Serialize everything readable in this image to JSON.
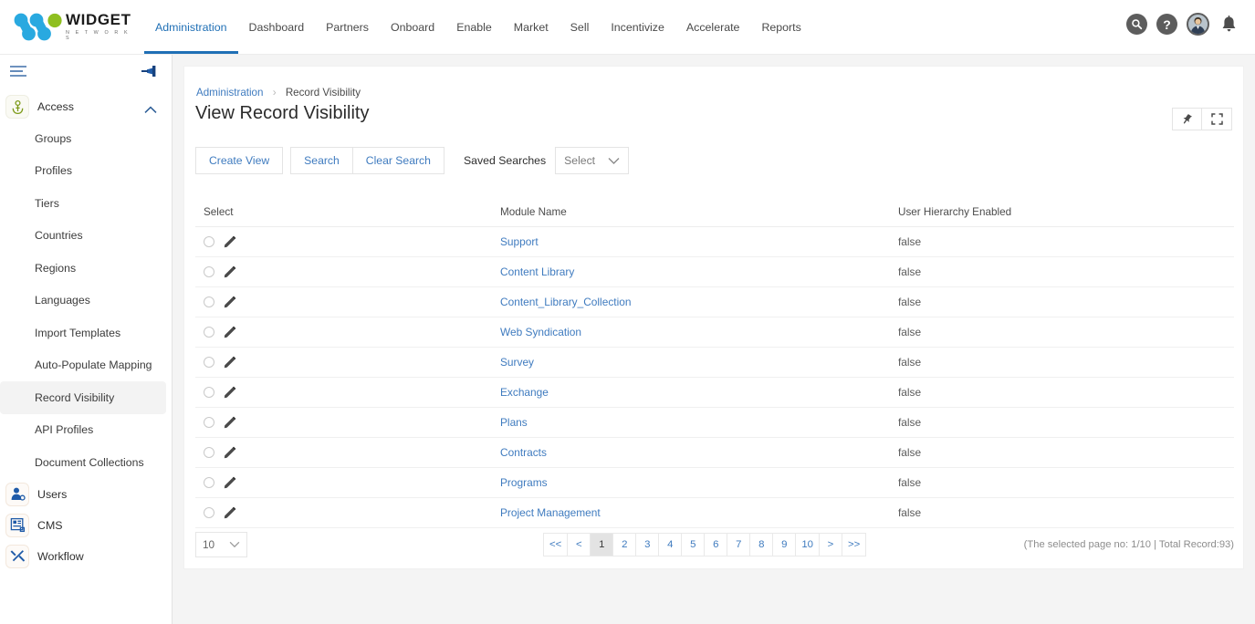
{
  "brand": {
    "name": "WIDGET",
    "tagline": "N E T W O R K S",
    "logo_colors": {
      "blue": "#29a9e0",
      "green": "#8fbf20"
    }
  },
  "topnav": {
    "items": [
      {
        "label": "Administration",
        "active": true
      },
      {
        "label": "Dashboard",
        "active": false
      },
      {
        "label": "Partners",
        "active": false
      },
      {
        "label": "Onboard",
        "active": false
      },
      {
        "label": "Enable",
        "active": false
      },
      {
        "label": "Market",
        "active": false
      },
      {
        "label": "Sell",
        "active": false
      },
      {
        "label": "Incentivize",
        "active": false
      },
      {
        "label": "Accelerate",
        "active": false
      },
      {
        "label": "Reports",
        "active": false
      }
    ],
    "icons": [
      "search-icon",
      "help-icon",
      "user-avatar",
      "notification-bell-icon"
    ],
    "accent": "#1f6fb5"
  },
  "sidebar": {
    "menu_icon": "hamburger-icon",
    "pin_icon": "pin-icon",
    "sections": [
      {
        "label": "Access",
        "icon": "access-key-icon",
        "expanded": true,
        "chevron": "chevron-up-icon",
        "items": [
          {
            "label": "Groups",
            "active": false
          },
          {
            "label": "Profiles",
            "active": false
          },
          {
            "label": "Tiers",
            "active": false
          },
          {
            "label": "Countries",
            "active": false
          },
          {
            "label": "Regions",
            "active": false
          },
          {
            "label": "Languages",
            "active": false
          },
          {
            "label": "Import Templates",
            "active": false
          },
          {
            "label": "Auto-Populate Mapping",
            "active": false
          },
          {
            "label": "Record Visibility",
            "active": true
          },
          {
            "label": "API Profiles",
            "active": false
          },
          {
            "label": "Document Collections",
            "active": false
          }
        ]
      },
      {
        "label": "Users",
        "icon": "users-icon",
        "expanded": false,
        "items": []
      },
      {
        "label": "CMS",
        "icon": "cms-icon",
        "expanded": false,
        "items": []
      },
      {
        "label": "Workflow",
        "icon": "workflow-tools-icon",
        "expanded": false,
        "items": []
      }
    ]
  },
  "page": {
    "breadcrumb": {
      "parent": "Administration",
      "separator": "›",
      "current": "Record Visibility"
    },
    "title": "View Record Visibility",
    "panel_tools": [
      {
        "name": "pin-icon"
      },
      {
        "name": "expand-icon"
      }
    ]
  },
  "toolbar": {
    "create_view_label": "Create View",
    "search_label": "Search",
    "clear_search_label": "Clear Search",
    "saved_searches_label": "Saved Searches",
    "saved_searches_value": "Select",
    "dropdown_icon": "chevron-down-icon"
  },
  "table": {
    "columns": [
      "Select",
      "Module Name",
      "User Hierarchy Enabled"
    ],
    "rows": [
      {
        "module": "Support",
        "hierarchy": "false"
      },
      {
        "module": "Content Library",
        "hierarchy": "false"
      },
      {
        "module": "Content_Library_Collection",
        "hierarchy": "false"
      },
      {
        "module": "Web Syndication",
        "hierarchy": "false"
      },
      {
        "module": "Survey",
        "hierarchy": "false"
      },
      {
        "module": "Exchange",
        "hierarchy": "false"
      },
      {
        "module": "Plans",
        "hierarchy": "false"
      },
      {
        "module": "Contracts",
        "hierarchy": "false"
      },
      {
        "module": "Programs",
        "hierarchy": "false"
      },
      {
        "module": "Project Management",
        "hierarchy": "false"
      }
    ],
    "row_radio_icon": "radio-button-icon",
    "row_edit_icon": "pencil-edit-icon"
  },
  "pagination": {
    "page_size": "10",
    "page_size_icon": "chevron-down-icon",
    "buttons": [
      {
        "label": "<<",
        "active": false
      },
      {
        "label": "<",
        "active": false
      },
      {
        "label": "1",
        "active": true
      },
      {
        "label": "2",
        "active": false
      },
      {
        "label": "3",
        "active": false
      },
      {
        "label": "4",
        "active": false
      },
      {
        "label": "5",
        "active": false
      },
      {
        "label": "6",
        "active": false
      },
      {
        "label": "7",
        "active": false
      },
      {
        "label": "8",
        "active": false
      },
      {
        "label": "9",
        "active": false
      },
      {
        "label": "10",
        "active": false
      },
      {
        "label": ">",
        "active": false
      },
      {
        "label": ">>",
        "active": false
      }
    ],
    "record_info": "(The selected page no: 1/10 | Total Record:93)"
  }
}
